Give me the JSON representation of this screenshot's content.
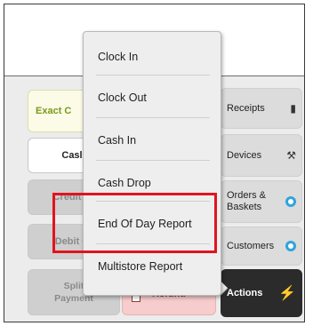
{
  "payment_tiles": {
    "exact": "Exact C",
    "cash": "Casl",
    "credit": "Credit C",
    "debit": "Debit C",
    "split_line1": "Split",
    "split_line2": "Payment",
    "refund": "Refund"
  },
  "side_nav": {
    "receipts": "Receipts",
    "devices": "Devices",
    "orders_line1": "Orders &",
    "orders_line2": "Baskets",
    "customers": "Customers",
    "actions": "Actions"
  },
  "actions_menu": {
    "items": [
      "Clock In",
      "Clock Out",
      "Cash In",
      "Cash Drop",
      "End Of Day Report",
      "Multistore Report"
    ],
    "highlighted": "End Of Day Report"
  },
  "colors": {
    "highlight_border": "#e0141f",
    "actions_bg": "#2b2b2b",
    "accent_blue": "#2fa4dd",
    "refund_bg": "#f6cccc"
  },
  "icons": {
    "receipts": "receipt-book-icon",
    "devices": "hammer-icon",
    "orders": "badge-icon",
    "customers": "badge-icon",
    "actions": "lightning-icon"
  }
}
